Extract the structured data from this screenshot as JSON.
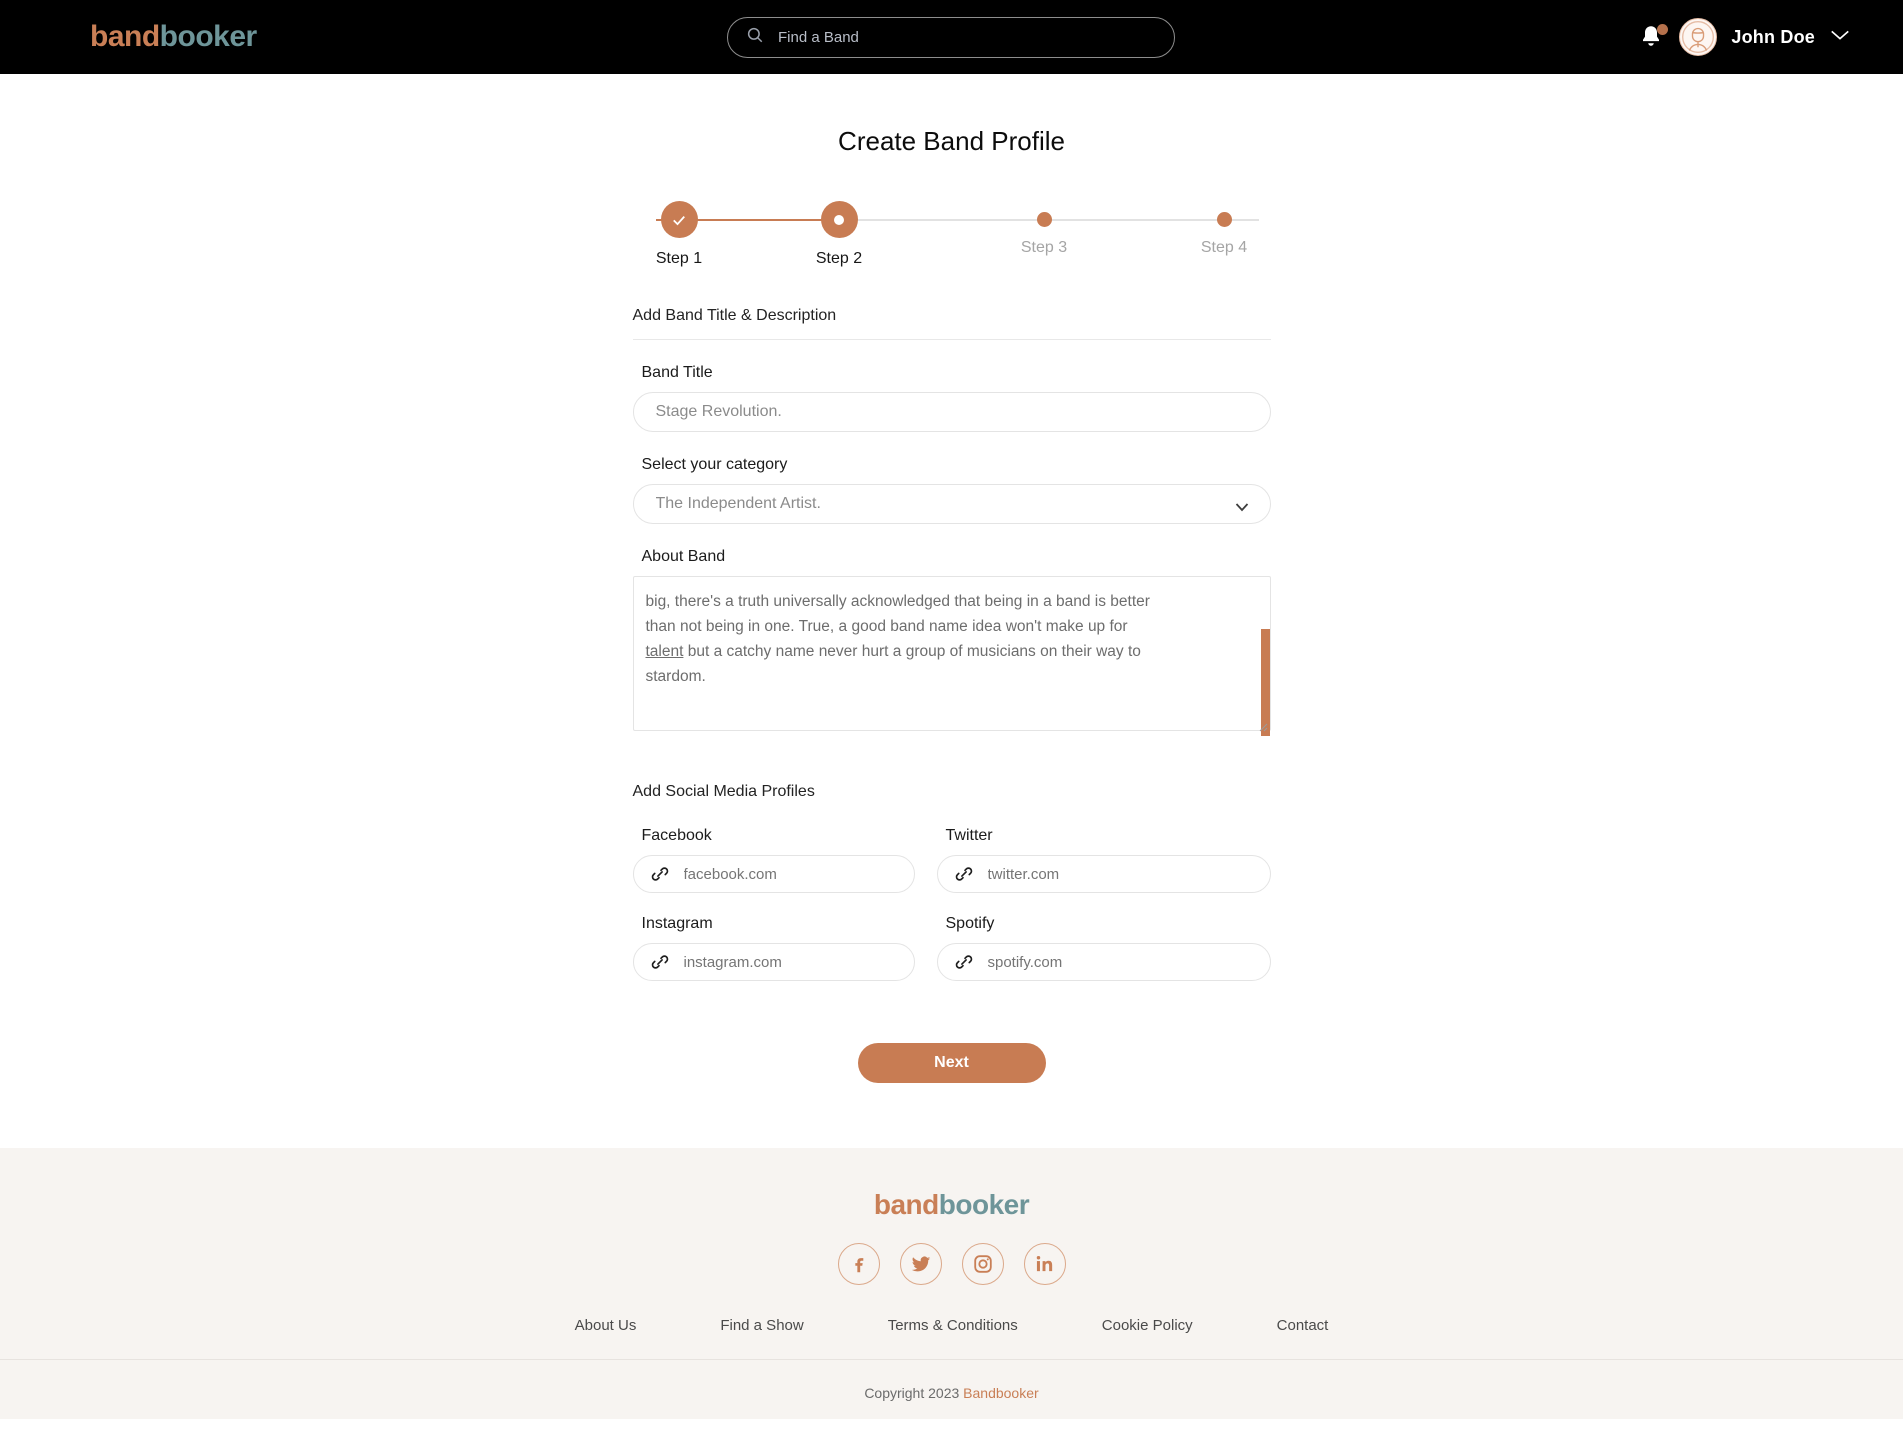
{
  "brand": {
    "name_part1": "band",
    "name_part2": "booker",
    "accent_orange": "#c87c53",
    "accent_teal": "#6e9599"
  },
  "topbar": {
    "search": {
      "placeholder": "Find a Band",
      "value": ""
    },
    "user_name": "John Doe",
    "has_notification": true
  },
  "main": {
    "page_title": "Create Band Profile",
    "stepper": {
      "steps": [
        {
          "label": "Step 1",
          "state": "completed"
        },
        {
          "label": "Step 2",
          "state": "active"
        },
        {
          "label": "Step 3",
          "state": "pending"
        },
        {
          "label": "Step 4",
          "state": "pending"
        }
      ]
    },
    "section_title": "Add Band Title & Description",
    "band_title": {
      "label": "Band Title",
      "placeholder": "Stage Revolution.",
      "value": ""
    },
    "category": {
      "label": "Select your category",
      "selected": "The Independent Artist.",
      "options": [
        "The Independent Artist."
      ]
    },
    "about": {
      "label": "About Band",
      "line1": "big, there's a truth universally acknowledged that being in a band is better",
      "line2": "than not being in one. True, a good band name idea won't make up for",
      "line3_link": "talent",
      "line3_rest": " but a catchy name never hurt a group of musicians on their way to",
      "line4": "stardom."
    },
    "social_section_title": "Add Social Media Profiles",
    "social_fields": [
      {
        "label": "Facebook",
        "placeholder": "facebook.com",
        "value": ""
      },
      {
        "label": "Twitter",
        "placeholder": "twitter.com",
        "value": ""
      },
      {
        "label": "Instagram",
        "placeholder": "instagram.com",
        "value": ""
      },
      {
        "label": "Spotify",
        "placeholder": "spotify.com",
        "value": ""
      }
    ],
    "next_label": "Next"
  },
  "footer": {
    "socials": [
      "facebook",
      "twitter",
      "instagram",
      "linkedin"
    ],
    "links": [
      "About Us",
      "Find a Show",
      "Terms & Conditions",
      "Cookie Policy",
      "Contact"
    ],
    "copyright_text": "Copyright 2023 ",
    "copyright_brand": "Bandbooker"
  }
}
